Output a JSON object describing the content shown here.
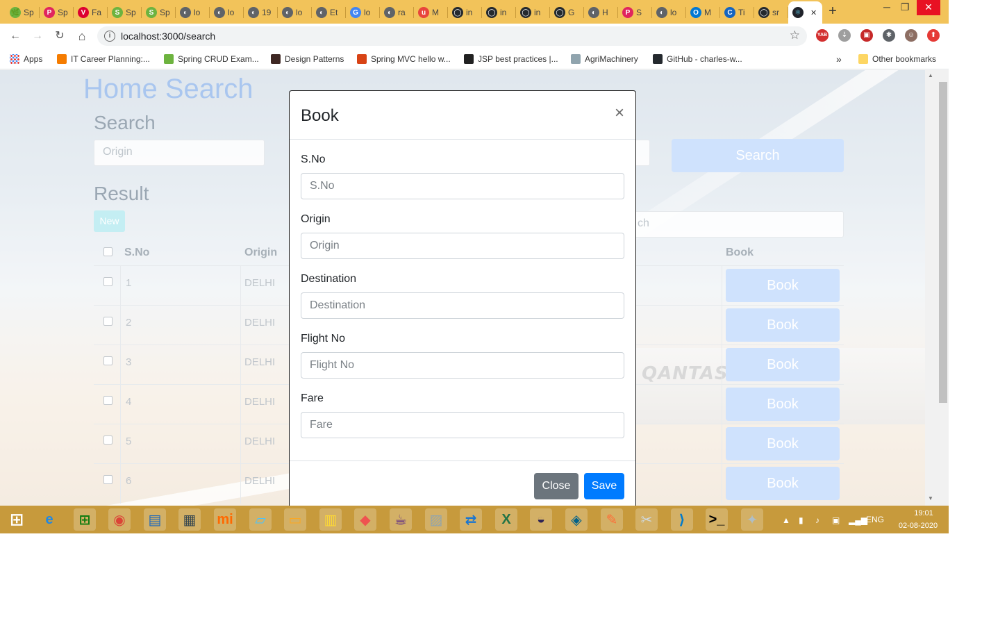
{
  "browser": {
    "tabs": [
      {
        "label": "Sp",
        "color": "#6db33f",
        "glyph": "🌿"
      },
      {
        "label": "Sp",
        "color": "#e0245e",
        "glyph": "P"
      },
      {
        "label": "Fa",
        "color": "#dd0031",
        "glyph": "V"
      },
      {
        "label": "Sp",
        "color": "#6db33f",
        "glyph": "S"
      },
      {
        "label": "Sp",
        "color": "#6db33f",
        "glyph": "S"
      },
      {
        "label": "lo",
        "color": "#5f6368",
        "glyph": "◐"
      },
      {
        "label": "lo",
        "color": "#5f6368",
        "glyph": "◐"
      },
      {
        "label": "19",
        "color": "#5f6368",
        "glyph": "◐"
      },
      {
        "label": "lo",
        "color": "#5f6368",
        "glyph": "◐"
      },
      {
        "label": "Et",
        "color": "#5f6368",
        "glyph": "◐"
      },
      {
        "label": "lo",
        "color": "#4285f4",
        "glyph": "G"
      },
      {
        "label": "ra",
        "color": "#5f6368",
        "glyph": "◐"
      },
      {
        "label": "M",
        "color": "#e8453c",
        "glyph": "u"
      },
      {
        "label": "in",
        "color": "#24292e",
        "glyph": "◯"
      },
      {
        "label": "in",
        "color": "#24292e",
        "glyph": "◯"
      },
      {
        "label": "in",
        "color": "#24292e",
        "glyph": "◯"
      },
      {
        "label": "G",
        "color": "#24292e",
        "glyph": "◯"
      },
      {
        "label": "H",
        "color": "#5f6368",
        "glyph": "◐"
      },
      {
        "label": "S",
        "color": "#e0245e",
        "glyph": "P"
      },
      {
        "label": "lo",
        "color": "#5f6368",
        "glyph": "◐"
      },
      {
        "label": "M",
        "color": "#0078d4",
        "glyph": "O"
      },
      {
        "label": "Ti",
        "color": "#1565c0",
        "glyph": "C"
      },
      {
        "label": "sr",
        "color": "#24292e",
        "glyph": "◯"
      }
    ],
    "active_tab": {
      "color": "#20232a",
      "glyph": "⚛"
    },
    "new_tab": "+",
    "window_controls": {
      "minimize": "─",
      "restore": "❐",
      "close": "✕"
    },
    "nav": {
      "back": "←",
      "forward": "→",
      "reload": "↻",
      "home": "⌂"
    },
    "url": "localhost:3000/search",
    "info_icon": "i",
    "bookmark_star": "☆",
    "extensions": [
      {
        "color": "#d32f2f",
        "glyph": "YAB"
      },
      {
        "color": "#9e9e9e",
        "glyph": "⇣"
      },
      {
        "color": "#c62828",
        "glyph": "▣"
      },
      {
        "color": "#5f6368",
        "glyph": "✱"
      },
      {
        "color": "#8d6e63",
        "glyph": "☺"
      },
      {
        "color": "#e53935",
        "glyph": "⬆"
      }
    ],
    "bookmarks": [
      {
        "label": "Apps",
        "color": "#4285f4"
      },
      {
        "label": "IT Career Planning:...",
        "color": "#f57c00"
      },
      {
        "label": "Spring CRUD Exam...",
        "color": "#6db33f"
      },
      {
        "label": "Design Patterns",
        "color": "#3e2723"
      },
      {
        "label": "Spring MVC hello w...",
        "color": "#d84315"
      },
      {
        "label": "JSP best practices |...",
        "color": "#212121"
      },
      {
        "label": "AgriMachinery",
        "color": "#90a4ae"
      },
      {
        "label": "GitHub - charles-w...",
        "color": "#24292e"
      }
    ],
    "bookmarks_overflow": "»",
    "other_bookmarks": "Other bookmarks"
  },
  "page": {
    "title": "Home Search",
    "search_heading": "Search",
    "origin_placeholder": "Origin",
    "search_button": "Search",
    "result_heading": "Result",
    "new_button": "New",
    "filter_placeholder_fragment": "ch",
    "background_brand_text": "QANTAS",
    "table": {
      "headers": {
        "sno": "S.No",
        "origin": "Origin",
        "book": "Book"
      },
      "rows": [
        {
          "sno": "1",
          "origin": "DELHI",
          "action": "Book"
        },
        {
          "sno": "2",
          "origin": "DELHI",
          "action": "Book"
        },
        {
          "sno": "3",
          "origin": "DELHI",
          "action": "Book"
        },
        {
          "sno": "4",
          "origin": "DELHI",
          "action": "Book"
        },
        {
          "sno": "5",
          "origin": "DELHI",
          "action": "Book"
        },
        {
          "sno": "6",
          "origin": "DELHI",
          "action": "Book"
        }
      ]
    }
  },
  "modal": {
    "title": "Book",
    "close_glyph": "×",
    "fields": [
      {
        "label": "S.No",
        "placeholder": "S.No"
      },
      {
        "label": "Origin",
        "placeholder": "Origin"
      },
      {
        "label": "Destination",
        "placeholder": "Destination"
      },
      {
        "label": "Flight No",
        "placeholder": "Flight No"
      },
      {
        "label": "Fare",
        "placeholder": "Fare"
      }
    ],
    "close_button": "Close",
    "save_button": "Save"
  },
  "taskbar": {
    "icons": [
      {
        "name": "windows-start-icon",
        "color": "#ffffff",
        "glyph": "⊞"
      },
      {
        "name": "internet-explorer-icon",
        "color": "#1e88e5",
        "glyph": "e"
      },
      {
        "name": "store-icon",
        "color": "#107c10",
        "glyph": "⊞"
      },
      {
        "name": "chrome-icon",
        "color": "#db4437",
        "glyph": "◉"
      },
      {
        "name": "remote-desktop-icon",
        "color": "#1565c0",
        "glyph": "▤"
      },
      {
        "name": "network-tool-icon",
        "color": "#37474f",
        "glyph": "▦"
      },
      {
        "name": "mi-icon",
        "color": "#ff6900",
        "glyph": "mi"
      },
      {
        "name": "notes-icon",
        "color": "#4fc3f7",
        "glyph": "▱"
      },
      {
        "name": "file-explorer-icon",
        "color": "#f9a825",
        "glyph": "▭"
      },
      {
        "name": "activity-monitor-icon",
        "color": "#fdd835",
        "glyph": "▥"
      },
      {
        "name": "shapes-app-icon",
        "color": "#ef5350",
        "glyph": "◆"
      },
      {
        "name": "java-ee-ide-icon",
        "color": "#4a148c",
        "glyph": "☕"
      },
      {
        "name": "image-viewer-icon",
        "color": "#90a4ae",
        "glyph": "▨"
      },
      {
        "name": "file-transfer-icon",
        "color": "#1976d2",
        "glyph": "⇄"
      },
      {
        "name": "excel-icon",
        "color": "#217346",
        "glyph": "X"
      },
      {
        "name": "eclipse-icon",
        "color": "#2c2255",
        "glyph": "◒"
      },
      {
        "name": "mysql-workbench-icon",
        "color": "#00618a",
        "glyph": "◈"
      },
      {
        "name": "postman-icon",
        "color": "#ff6c37",
        "glyph": "✎"
      },
      {
        "name": "snipping-tool-icon",
        "color": "#cfd8dc",
        "glyph": "✂"
      },
      {
        "name": "vscode-icon",
        "color": "#007acc",
        "glyph": "⟩"
      },
      {
        "name": "command-prompt-icon",
        "color": "#000000",
        "glyph": ">_"
      },
      {
        "name": "paint-icon",
        "color": "#b0bec5",
        "glyph": "✦"
      }
    ],
    "tray_glyphs": [
      "▲",
      "▮",
      "♪",
      "▣",
      "▂▄▆"
    ],
    "language": "ENG",
    "time": "19:01",
    "date": "02-08-2020"
  }
}
